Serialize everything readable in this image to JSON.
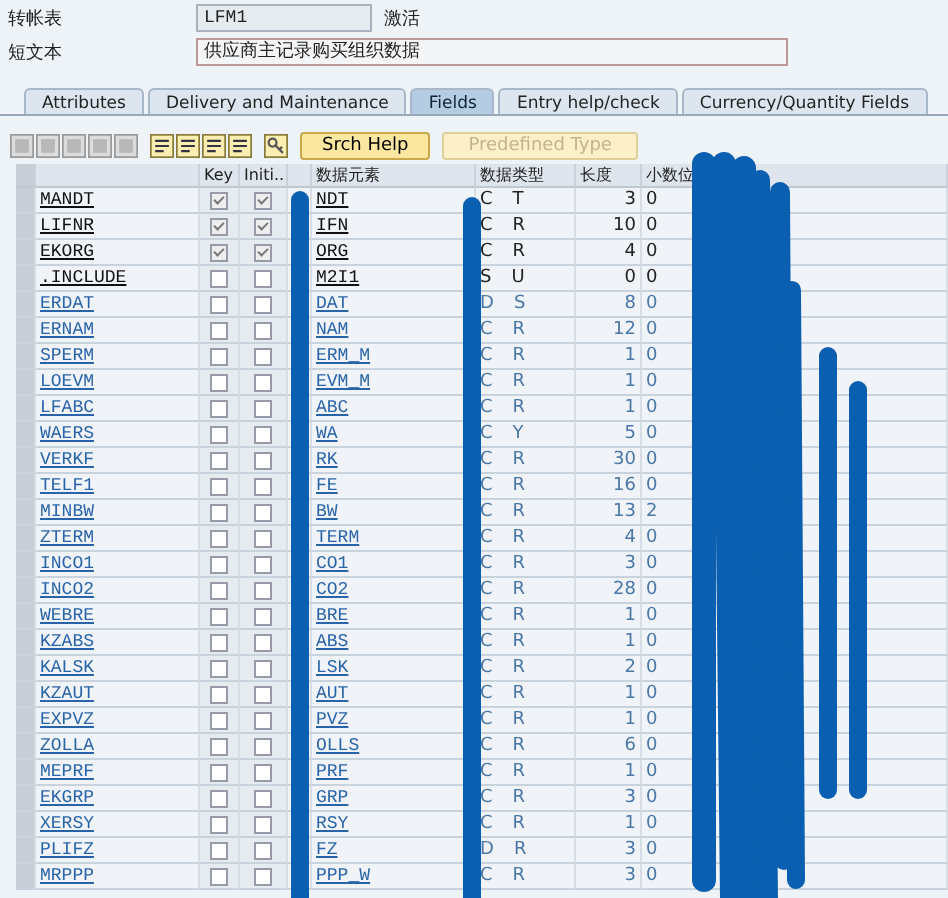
{
  "header": {
    "table_label": "转帐表",
    "table_value": "LFM1",
    "status": "激活",
    "short_text_label": "短文本",
    "short_text_value": "供应商主记录购买组织数据"
  },
  "tabs": [
    {
      "label": "Attributes",
      "selected": false
    },
    {
      "label": "Delivery and Maintenance",
      "selected": false
    },
    {
      "label": "Fields",
      "selected": true
    },
    {
      "label": "Entry help/check",
      "selected": false
    },
    {
      "label": "Currency/Quantity Fields",
      "selected": false
    }
  ],
  "toolbar": {
    "search_help": "Srch Help",
    "predefined_type": "Predefined Type",
    "predefined_disabled": true
  },
  "table": {
    "columns": [
      "Key",
      "Initi...",
      "数据元素",
      "数据类型",
      "长度",
      "小数位"
    ],
    "rows": [
      {
        "field": "MANDT",
        "link": false,
        "key": true,
        "initial": true,
        "element": "NDT",
        "type_head": "C",
        "type_tail": "T",
        "length": "3",
        "decimals": "0"
      },
      {
        "field": "LIFNR",
        "link": false,
        "key": true,
        "initial": true,
        "element": "IFN",
        "type_head": "C",
        "type_tail": "R",
        "length": "10",
        "decimals": "0"
      },
      {
        "field": "EKORG",
        "link": false,
        "key": true,
        "initial": true,
        "element": "ORG",
        "type_head": "C",
        "type_tail": "R",
        "length": "4",
        "decimals": "0"
      },
      {
        "field": ".INCLUDE",
        "link": false,
        "key": false,
        "initial": false,
        "element": "M2I1",
        "type_head": "S",
        "type_tail": "U",
        "length": "0",
        "decimals": "0"
      },
      {
        "field": "ERDAT",
        "link": true,
        "key": false,
        "initial": false,
        "element": "DAT",
        "type_head": "D",
        "type_tail": "S",
        "length": "8",
        "decimals": "0"
      },
      {
        "field": "ERNAM",
        "link": true,
        "key": false,
        "initial": false,
        "element": "NAM",
        "type_head": "C",
        "type_tail": "R",
        "length": "12",
        "decimals": "0"
      },
      {
        "field": "SPERM",
        "link": true,
        "key": false,
        "initial": false,
        "element": "ERM_M",
        "type_head": "C",
        "type_tail": "R",
        "length": "1",
        "decimals": "0"
      },
      {
        "field": "LOEVM",
        "link": true,
        "key": false,
        "initial": false,
        "element": "EVM_M",
        "type_head": "C",
        "type_tail": "R",
        "length": "1",
        "decimals": "0"
      },
      {
        "field": "LFABC",
        "link": true,
        "key": false,
        "initial": false,
        "element": "ABC",
        "type_head": "C",
        "type_tail": "R",
        "length": "1",
        "decimals": "0"
      },
      {
        "field": "WAERS",
        "link": true,
        "key": false,
        "initial": false,
        "element": "WA",
        "type_head": "C",
        "type_tail": "Y",
        "length": "5",
        "decimals": "0"
      },
      {
        "field": "VERKF",
        "link": true,
        "key": false,
        "initial": false,
        "element": "RK",
        "type_head": "C",
        "type_tail": "R",
        "length": "30",
        "decimals": "0"
      },
      {
        "field": "TELF1",
        "link": true,
        "key": false,
        "initial": false,
        "element": "FE",
        "type_head": "C",
        "type_tail": "R",
        "length": "16",
        "decimals": "0"
      },
      {
        "field": "MINBW",
        "link": true,
        "key": false,
        "initial": false,
        "element": "BW",
        "type_head": "C",
        "type_tail": "R",
        "length": "13",
        "decimals": "2"
      },
      {
        "field": "ZTERM",
        "link": true,
        "key": false,
        "initial": false,
        "element": "TERM",
        "type_head": "C",
        "type_tail": "R",
        "length": "4",
        "decimals": "0"
      },
      {
        "field": "INCO1",
        "link": true,
        "key": false,
        "initial": false,
        "element": "CO1",
        "type_head": "C",
        "type_tail": "R",
        "length": "3",
        "decimals": "0"
      },
      {
        "field": "INCO2",
        "link": true,
        "key": false,
        "initial": false,
        "element": "CO2",
        "type_head": "C",
        "type_tail": "R",
        "length": "28",
        "decimals": "0"
      },
      {
        "field": "WEBRE",
        "link": true,
        "key": false,
        "initial": false,
        "element": "BRE",
        "type_head": "C",
        "type_tail": "R",
        "length": "1",
        "decimals": "0"
      },
      {
        "field": "KZABS",
        "link": true,
        "key": false,
        "initial": false,
        "element": "ABS",
        "type_head": "C",
        "type_tail": "R",
        "length": "1",
        "decimals": "0"
      },
      {
        "field": "KALSK",
        "link": true,
        "key": false,
        "initial": false,
        "element": "LSK",
        "type_head": "C",
        "type_tail": "R",
        "length": "2",
        "decimals": "0"
      },
      {
        "field": "KZAUT",
        "link": true,
        "key": false,
        "initial": false,
        "element": "AUT",
        "type_head": "C",
        "type_tail": "R",
        "length": "1",
        "decimals": "0"
      },
      {
        "field": "EXPVZ",
        "link": true,
        "key": false,
        "initial": false,
        "element": "PVZ",
        "type_head": "C",
        "type_tail": "R",
        "length": "1",
        "decimals": "0"
      },
      {
        "field": "ZOLLA",
        "link": true,
        "key": false,
        "initial": false,
        "element": "OLLS",
        "type_head": "C",
        "type_tail": "R",
        "length": "6",
        "decimals": "0"
      },
      {
        "field": "MEPRF",
        "link": true,
        "key": false,
        "initial": false,
        "element": "PRF",
        "type_head": "C",
        "type_tail": "R",
        "length": "1",
        "decimals": "0"
      },
      {
        "field": "EKGRP",
        "link": true,
        "key": false,
        "initial": false,
        "element": "GRP",
        "type_head": "C",
        "type_tail": "R",
        "length": "3",
        "decimals": "0"
      },
      {
        "field": "XERSY",
        "link": true,
        "key": false,
        "initial": false,
        "element": "RSY",
        "type_head": "C",
        "type_tail": "R",
        "length": "1",
        "decimals": "0"
      },
      {
        "field": "PLIFZ",
        "link": true,
        "key": false,
        "initial": false,
        "element": "FZ",
        "type_head": "D",
        "type_tail": "R",
        "length": "3",
        "decimals": "0"
      },
      {
        "field": "MRPPP",
        "link": true,
        "key": false,
        "initial": false,
        "element": "PPP_W",
        "type_head": "C",
        "type_tail": "R",
        "length": "3",
        "decimals": "0"
      }
    ]
  }
}
